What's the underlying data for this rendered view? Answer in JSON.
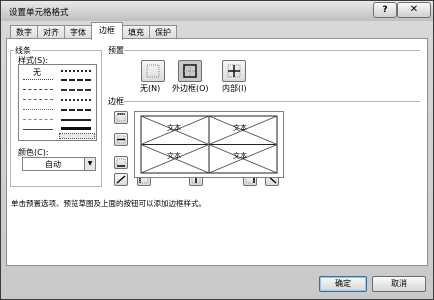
{
  "window": {
    "title": "设置单元格格式",
    "help_icon": "?",
    "close_icon": "✕"
  },
  "tabs": [
    {
      "label": "数字"
    },
    {
      "label": "对齐"
    },
    {
      "label": "字体"
    },
    {
      "label": "边框",
      "active": true
    },
    {
      "label": "填充"
    },
    {
      "label": "保护"
    }
  ],
  "line_group": {
    "title": "线条",
    "style_label": "样式(S):",
    "none_label": "无",
    "color_label": "颜色(C):",
    "color_value": "自动"
  },
  "presets": {
    "title": "预置",
    "items": [
      {
        "label": "无(N)",
        "icon": "no-border-icon"
      },
      {
        "label": "外边框(O)",
        "icon": "outline-border-icon"
      },
      {
        "label": "内部(I)",
        "icon": "inside-border-icon"
      }
    ]
  },
  "border": {
    "title": "边框",
    "preview_text": [
      "文本",
      "文本",
      "文本",
      "文本"
    ]
  },
  "hint_text": "单击预置选项、预览草图及上面的按钮可以添加边框样式。",
  "buttons": {
    "ok": "确定",
    "cancel": "取消"
  },
  "colors": {
    "accent": "#3a6ea5",
    "dialog_bg": "#d4d4d4"
  }
}
